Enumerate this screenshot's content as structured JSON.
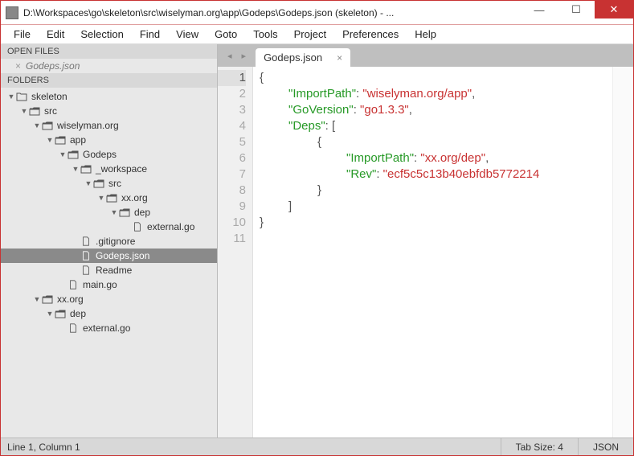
{
  "window": {
    "title": "D:\\Workspaces\\go\\skeleton\\src\\wiselyman.org\\app\\Godeps\\Godeps.json (skeleton) - ..."
  },
  "menu": [
    "File",
    "Edit",
    "Selection",
    "Find",
    "View",
    "Goto",
    "Tools",
    "Project",
    "Preferences",
    "Help"
  ],
  "open_files_header": "OPEN FILES",
  "open_file": "Godeps.json",
  "folders_header": "FOLDERS",
  "tree": [
    {
      "depth": 0,
      "arrow": "▼",
      "icon": "folder",
      "label": "skeleton"
    },
    {
      "depth": 1,
      "arrow": "▼",
      "icon": "folder-open",
      "label": "src"
    },
    {
      "depth": 2,
      "arrow": "▼",
      "icon": "folder-open",
      "label": "wiselyman.org"
    },
    {
      "depth": 3,
      "arrow": "▼",
      "icon": "folder-open",
      "label": "app"
    },
    {
      "depth": 4,
      "arrow": "▼",
      "icon": "folder-open",
      "label": "Godeps"
    },
    {
      "depth": 5,
      "arrow": "▼",
      "icon": "folder-open",
      "label": "_workspace"
    },
    {
      "depth": 6,
      "arrow": "▼",
      "icon": "folder-open",
      "label": "src"
    },
    {
      "depth": 7,
      "arrow": "▼",
      "icon": "folder-open",
      "label": "xx.org"
    },
    {
      "depth": 8,
      "arrow": "▼",
      "icon": "folder-open",
      "label": "dep"
    },
    {
      "depth": 9,
      "arrow": "",
      "icon": "file",
      "label": "external.go"
    },
    {
      "depth": 5,
      "arrow": "",
      "icon": "file",
      "label": ".gitignore"
    },
    {
      "depth": 5,
      "arrow": "",
      "icon": "file",
      "label": "Godeps.json",
      "selected": true
    },
    {
      "depth": 5,
      "arrow": "",
      "icon": "file",
      "label": "Readme"
    },
    {
      "depth": 4,
      "arrow": "",
      "icon": "file",
      "label": "main.go"
    },
    {
      "depth": 2,
      "arrow": "▼",
      "icon": "folder-open",
      "label": "xx.org"
    },
    {
      "depth": 3,
      "arrow": "▼",
      "icon": "folder-open",
      "label": "dep"
    },
    {
      "depth": 4,
      "arrow": "",
      "icon": "file",
      "label": "external.go"
    }
  ],
  "tab": {
    "label": "Godeps.json"
  },
  "code_lines": [
    [
      {
        "t": "punc",
        "v": "{"
      }
    ],
    [
      {
        "t": "pad",
        "w": 4
      },
      {
        "t": "key",
        "v": "\"ImportPath\""
      },
      {
        "t": "punc",
        "v": ": "
      },
      {
        "t": "str",
        "v": "\"wiselyman.org/app\""
      },
      {
        "t": "punc",
        "v": ","
      }
    ],
    [
      {
        "t": "pad",
        "w": 4
      },
      {
        "t": "key",
        "v": "\"GoVersion\""
      },
      {
        "t": "punc",
        "v": ": "
      },
      {
        "t": "str",
        "v": "\"go1.3.3\""
      },
      {
        "t": "punc",
        "v": ","
      }
    ],
    [
      {
        "t": "pad",
        "w": 4
      },
      {
        "t": "key",
        "v": "\"Deps\""
      },
      {
        "t": "punc",
        "v": ": ["
      }
    ],
    [
      {
        "t": "pad",
        "w": 8
      },
      {
        "t": "punc",
        "v": "{"
      }
    ],
    [
      {
        "t": "pad",
        "w": 12
      },
      {
        "t": "key",
        "v": "\"ImportPath\""
      },
      {
        "t": "punc",
        "v": ": "
      },
      {
        "t": "str",
        "v": "\"xx.org/dep\""
      },
      {
        "t": "punc",
        "v": ","
      }
    ],
    [
      {
        "t": "pad",
        "w": 12
      },
      {
        "t": "key",
        "v": "\"Rev\""
      },
      {
        "t": "punc",
        "v": ": "
      },
      {
        "t": "str",
        "v": "\"ecf5c5c13b40ebfdb5772214"
      }
    ],
    [
      {
        "t": "pad",
        "w": 8
      },
      {
        "t": "punc",
        "v": "}"
      }
    ],
    [
      {
        "t": "pad",
        "w": 4
      },
      {
        "t": "punc",
        "v": "]"
      }
    ],
    [
      {
        "t": "punc",
        "v": "}"
      }
    ],
    []
  ],
  "status": {
    "pos": "Line 1, Column 1",
    "tabsize": "Tab Size: 4",
    "lang": "JSON"
  }
}
